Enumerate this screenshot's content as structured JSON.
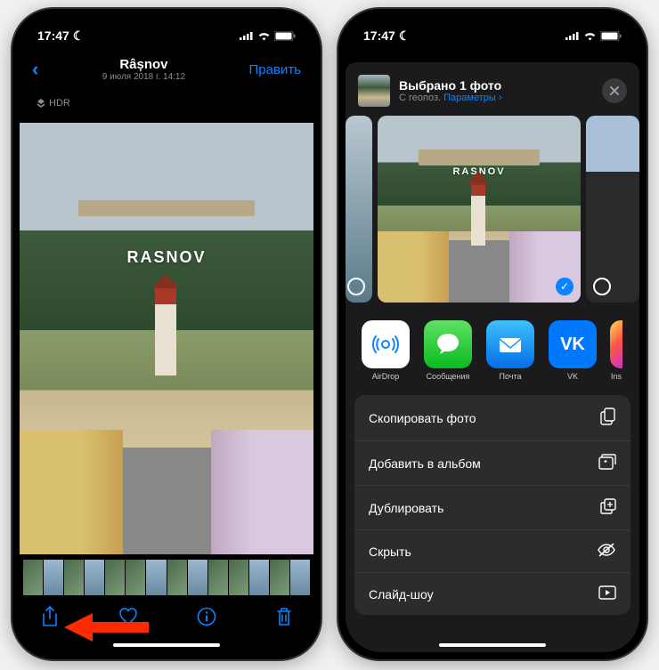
{
  "status": {
    "time": "17:47",
    "moon": "☾"
  },
  "phone1": {
    "header": {
      "title": "Râșnov",
      "subtitle": "9 июля 2018 г. 14:12",
      "edit": "Править"
    },
    "hdr": "HDR",
    "hill_sign": "RASNOV"
  },
  "phone2": {
    "sheet": {
      "title": "Выбрано 1 фото",
      "geo": "С геопоз.",
      "options": "Параметры ›"
    },
    "hill_sign": "RASNOV",
    "apps": {
      "airdrop": "AirDrop",
      "messages": "Сообщения",
      "mail": "Почта",
      "vk": "VK",
      "vk_glyph": "VK",
      "insta": "Ins"
    },
    "actions": {
      "copy": "Скопировать фото",
      "album": "Добавить в альбом",
      "duplicate": "Дублировать",
      "hide": "Скрыть",
      "slideshow": "Слайд-шоу"
    }
  }
}
